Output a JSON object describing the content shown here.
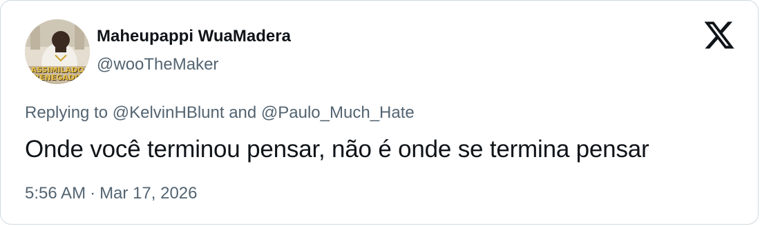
{
  "author": {
    "display_name": "Maheupappi WuaMadera",
    "handle": "@wooTheMaker",
    "avatar_text": "ASSIMILADO RENEGADO"
  },
  "reply": {
    "prefix": "Replying to",
    "mention_1": "@KelvinHBlunt",
    "conjunction": "and",
    "mention_2": "@Paulo_Much_Hate"
  },
  "tweet": {
    "text": "Onde você terminou pensar, não é onde se termina pensar"
  },
  "meta": {
    "time": "5:56 AM",
    "separator": "·",
    "date": "Mar 17, 2026"
  },
  "icons": {
    "platform_logo": "x-logo-icon"
  },
  "colors": {
    "text_primary": "#0f1419",
    "text_secondary": "#536471",
    "border": "#cfd9de",
    "avatar_banner": "#c9a227"
  }
}
